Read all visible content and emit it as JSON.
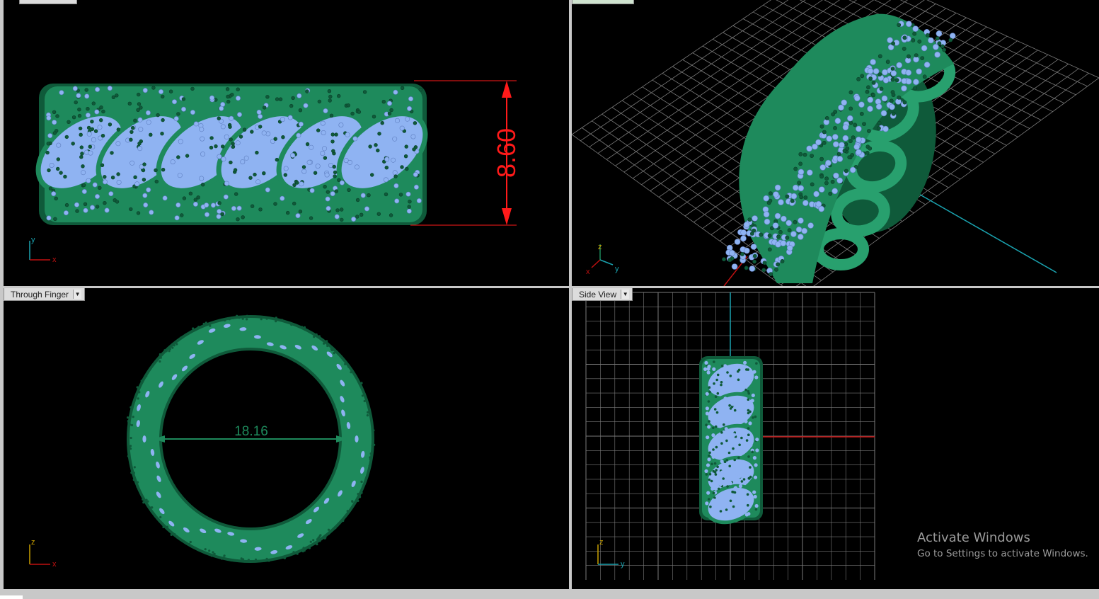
{
  "viewports": {
    "top_left": {
      "label": "",
      "dimension": "8.60",
      "axis_x": "x",
      "axis_y": "y"
    },
    "top_right": {
      "label": "",
      "axis_x": "x",
      "axis_y": "y",
      "axis_z": "z"
    },
    "bottom_left": {
      "label": "Through Finger",
      "dimension": "18.16",
      "axis_x": "x",
      "axis_z": "z"
    },
    "bottom_right": {
      "label": "Side View",
      "axis_y": "y",
      "axis_z": "z"
    }
  },
  "watermark": {
    "title": "Activate Windows",
    "subtitle": "Go to Settings to activate Windows."
  },
  "colors": {
    "metal": "#1e8a5c",
    "metal_dark": "#0f5a3a",
    "gem": "#8fb3f2",
    "dimension_red": "#ff1a1a",
    "dimension_green": "#1e8a5c",
    "grid": "#7a7a7a",
    "axis_red": "#c01010",
    "axis_teal": "#1aa3b0"
  }
}
